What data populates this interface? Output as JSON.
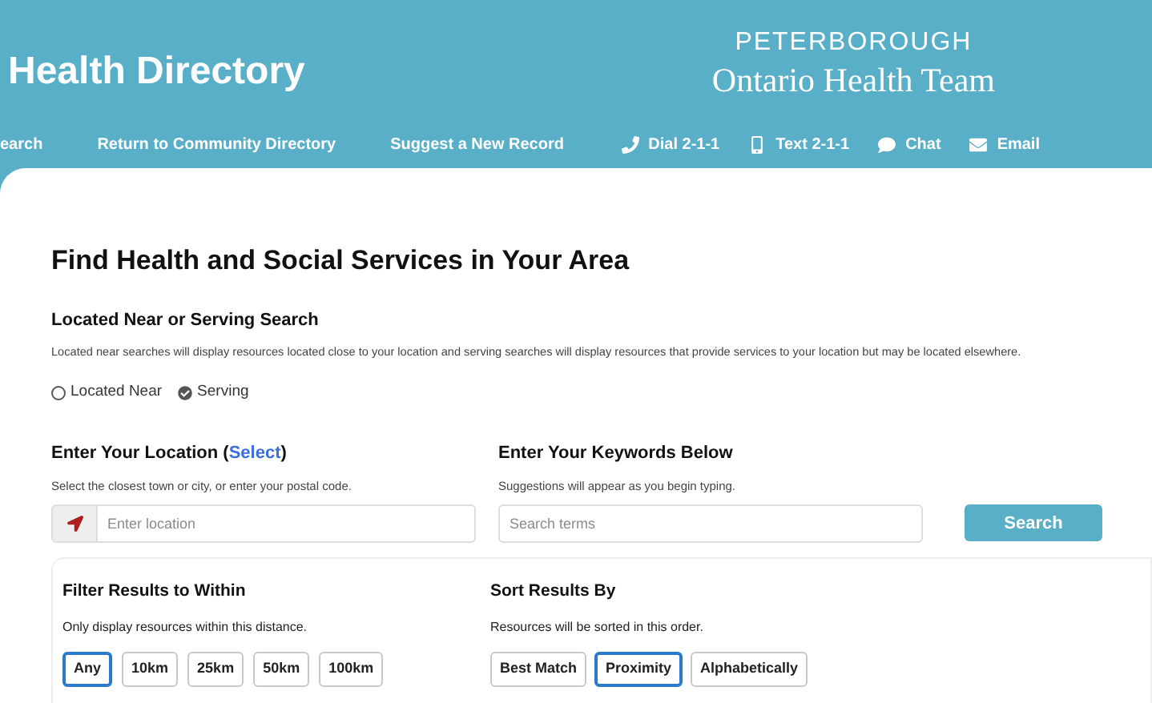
{
  "header": {
    "title": "Health Directory",
    "logo_top": "PETERBOROUGH",
    "logo_bottom": "Ontario Health Team"
  },
  "nav": [
    {
      "label": "earch"
    },
    {
      "label": "Return to Community Directory"
    },
    {
      "label": "Suggest a New Record"
    }
  ],
  "contact": [
    {
      "kind": "phone",
      "label": "Dial 2-1-1"
    },
    {
      "kind": "mobile",
      "label": "Text 2-1-1"
    },
    {
      "kind": "chat",
      "label": "Chat"
    },
    {
      "kind": "email",
      "label": "Email"
    }
  ],
  "heading": "Find Health and Social Services in Your Area",
  "search_type": {
    "title": "Located Near or Serving Search",
    "description": "Located near searches will display resources located close to your location and serving searches will display resources that provide services to your location but may be located elsewhere.",
    "options": [
      {
        "label": "Located Near",
        "selected": false
      },
      {
        "label": "Serving",
        "selected": true
      }
    ]
  },
  "location": {
    "title_before": "Enter Your Location (",
    "link": "Select",
    "title_after": ")",
    "hint": "Select the closest town or city, or enter your postal code.",
    "placeholder": "Enter location"
  },
  "keywords": {
    "title": "Enter Your Keywords Below",
    "hint": "Suggestions will appear as you begin typing.",
    "placeholder": "Search terms"
  },
  "search_button": "Search",
  "filter": {
    "title": "Filter Results to Within",
    "hint": "Only display resources within this distance.",
    "options": [
      {
        "label": "Any",
        "selected": true
      },
      {
        "label": "10km",
        "selected": false
      },
      {
        "label": "25km",
        "selected": false
      },
      {
        "label": "50km",
        "selected": false
      },
      {
        "label": "100km",
        "selected": false
      }
    ]
  },
  "sort": {
    "title": "Sort Results By",
    "hint": "Resources will be sorted in this order.",
    "options": [
      {
        "label": "Best Match",
        "selected": false
      },
      {
        "label": "Proximity",
        "selected": true
      },
      {
        "label": "Alphabetically",
        "selected": false
      }
    ]
  }
}
